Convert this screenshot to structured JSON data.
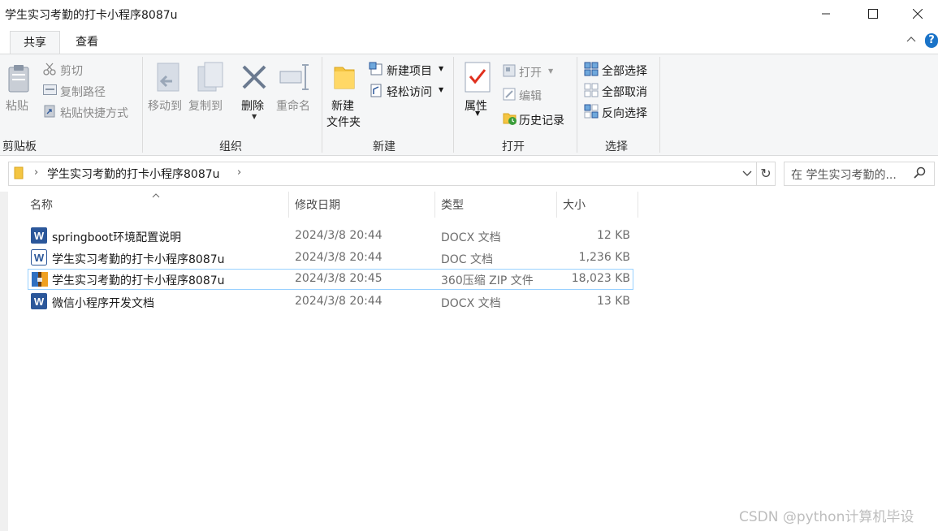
{
  "window": {
    "title": "学生实习考勤的打卡小程序8087u"
  },
  "ribbon_tabs": [
    {
      "label": "共享"
    },
    {
      "label": "查看"
    }
  ],
  "clipboard": {
    "paste": "粘贴",
    "cut": "剪切",
    "copy_path": "复制路径",
    "paste_shortcut": "粘贴快捷方式",
    "group": "剪贴板"
  },
  "organize": {
    "move_to": "移动到",
    "copy_to": "复制到",
    "delete": "删除",
    "rename": "重命名",
    "group": "组织"
  },
  "new": {
    "new_item": "新建项目",
    "easy_access": "轻松访问",
    "new_folder_line1": "新建",
    "new_folder_line2": "文件夹",
    "group": "新建"
  },
  "open": {
    "properties": "属性",
    "open": "打开",
    "edit": "编辑",
    "history": "历史记录",
    "group": "打开"
  },
  "select": {
    "select_all": "全部选择",
    "select_none": "全部取消",
    "invert": "反向选择",
    "group": "选择"
  },
  "address": {
    "path": "学生实习考勤的打卡小程序8087u"
  },
  "search": {
    "placeholder": "在 学生实习考勤的..."
  },
  "columns": {
    "name": "名称",
    "date": "修改日期",
    "type": "类型",
    "size": "大小"
  },
  "files": [
    {
      "name": "springboot环境配置说明",
      "date": "2024/3/8 20:44",
      "type": "DOCX 文档",
      "size": "12 KB",
      "icon": "word-icon"
    },
    {
      "name": "学生实习考勤的打卡小程序8087u",
      "date": "2024/3/8 20:44",
      "type": "DOC 文档",
      "size": "1,236 KB",
      "icon": "word-icon"
    },
    {
      "name": "学生实习考勤的打卡小程序8087u",
      "date": "2024/3/8 20:45",
      "type": "360压缩 ZIP 文件",
      "size": "18,023 KB",
      "icon": "zip-icon"
    },
    {
      "name": "微信小程序开发文档",
      "date": "2024/3/8 20:44",
      "type": "DOCX 文档",
      "size": "13 KB",
      "icon": "word-icon"
    }
  ],
  "watermark": "CSDN @python计算机毕设",
  "colors": {
    "accent": "#2b579a",
    "selection_border": "#99d1ff",
    "ribbon_bg": "#f5f6f7"
  }
}
